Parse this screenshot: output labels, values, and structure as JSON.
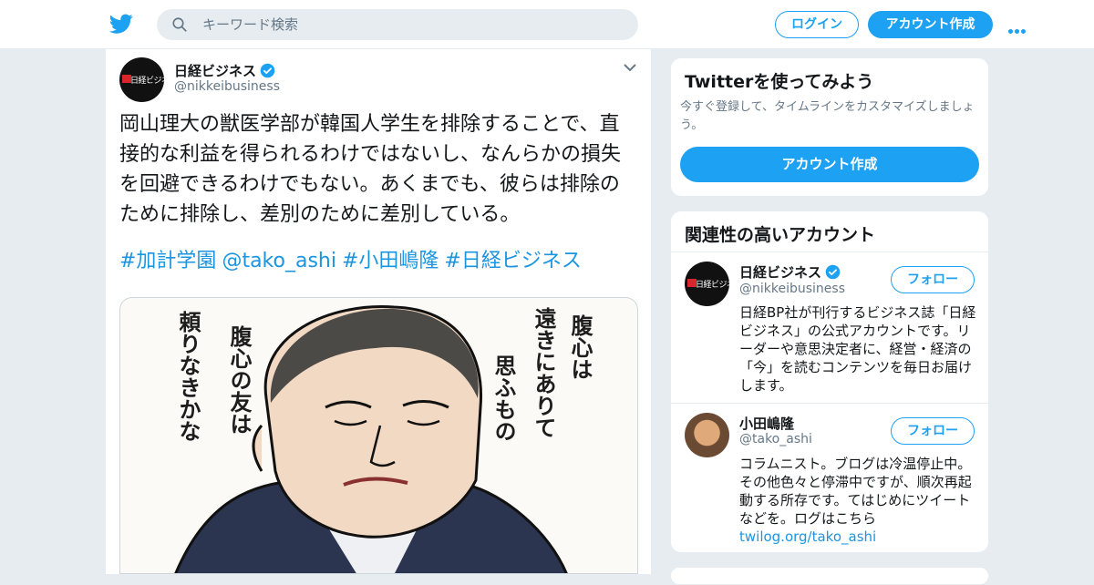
{
  "topbar": {
    "search_placeholder": "キーワード検索",
    "login_label": "ログイン",
    "signup_label": "アカウント作成"
  },
  "tweet": {
    "author_name": "日経ビジネス",
    "author_handle": "@nikkeibusiness",
    "avatar_text": "日経ビジネス",
    "text": "岡山理大の獣医学部が韓国人学生を排除することで、直接的な利益を得られるわけではないし、なんらかの損失を回避できるわけでもない。あくまでも、彼らは排除のために排除し、差別のために差別している。",
    "tags": [
      "#加計学園",
      "@tako_ashi",
      "#小田嶋隆",
      "#日経ビジネス"
    ],
    "image_text": {
      "col1": "腹心は",
      "col2": "遠きにありて",
      "col3": "思ふもの",
      "col4": "腹心の友は",
      "col5": "頼りなきかな"
    }
  },
  "sidebar": {
    "try_card": {
      "title": "Twitterを使ってみよう",
      "desc": "今すぐ登録して、タイムラインをカスタマイズしましょう。",
      "button": "アカウント作成"
    },
    "related": {
      "title": "関連性の高いアカウント",
      "accounts": [
        {
          "name": "日経ビジネス",
          "handle": "@nikkeibusiness",
          "bio": "日経BP社が刊行するビジネス誌「日経ビジネス」の公式アカウントです。リーダーや意思決定者に、経営・経済の「今」を読むコンテンツを毎日お届けします。",
          "follow": "フォロー"
        },
        {
          "name": "小田嶋隆",
          "handle": "@tako_ashi",
          "bio": "コラムニスト。ブログは冷温停止中。その他色々と停滞中ですが、順次再起動する所存です。てはじめにツイートなどを。ログはこちら",
          "link": "twilog.org/tako_ashi",
          "follow": "フォロー"
        }
      ]
    }
  },
  "colors": {
    "brand": "#1da1f2",
    "link": "#1b95e0",
    "background": "#e6ecf0"
  }
}
